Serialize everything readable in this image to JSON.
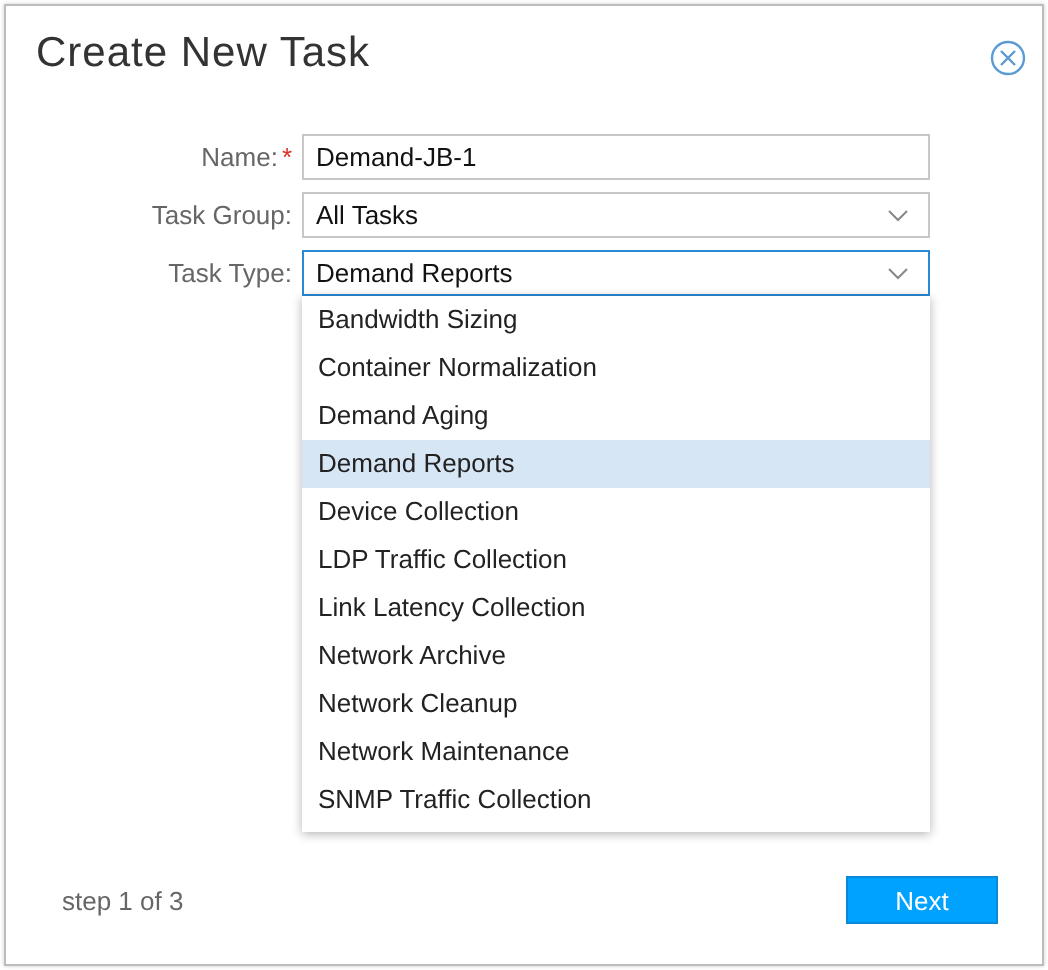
{
  "dialog": {
    "title": "Create New Task"
  },
  "fields": [
    {
      "kind": "text",
      "label": "Name:",
      "required_mark": "*",
      "value": "Demand-JB-1",
      "focused": false
    },
    {
      "kind": "select",
      "label": "Task Group:",
      "value": "All Tasks",
      "focused": false
    },
    {
      "kind": "select",
      "label": "Task Type:",
      "value": "Demand Reports",
      "focused": true
    }
  ],
  "dropdown": {
    "items": [
      {
        "label": "Bandwidth Sizing",
        "selected": false
      },
      {
        "label": "Container Normalization",
        "selected": false
      },
      {
        "label": "Demand Aging",
        "selected": false
      },
      {
        "label": "Demand Reports",
        "selected": true
      },
      {
        "label": "Device Collection",
        "selected": false
      },
      {
        "label": "LDP Traffic Collection",
        "selected": false
      },
      {
        "label": "Link Latency Collection",
        "selected": false
      },
      {
        "label": "Network Archive",
        "selected": false
      },
      {
        "label": "Network Cleanup",
        "selected": false
      },
      {
        "label": "Network Maintenance",
        "selected": false
      },
      {
        "label": "SNMP Traffic Collection",
        "selected": false
      }
    ]
  },
  "footer": {
    "step": "step 1 of 3",
    "button": "Next"
  }
}
